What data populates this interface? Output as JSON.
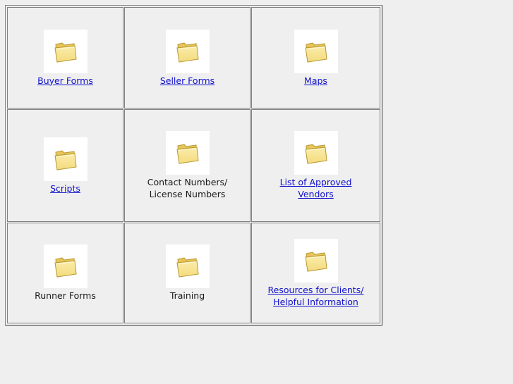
{
  "folders": [
    {
      "label": "Buyer Forms",
      "link": true,
      "icon": "folder-icon"
    },
    {
      "label": "Seller Forms",
      "link": true,
      "icon": "folder-icon"
    },
    {
      "label": "Maps",
      "link": true,
      "icon": "folder-icon"
    },
    {
      "label": "Scripts",
      "link": true,
      "icon": "folder-icon"
    },
    {
      "label": "Contact Numbers/\nLicense Numbers",
      "link": false,
      "icon": "folder-icon"
    },
    {
      "label": "List of Approved \nVendors",
      "link": true,
      "icon": "folder-icon"
    },
    {
      "label": "Runner Forms",
      "link": false,
      "icon": "folder-icon"
    },
    {
      "label": "Training",
      "link": false,
      "icon": "folder-icon"
    },
    {
      "label": "Resources for Clients/\nHelpful Information",
      "link": true,
      "icon": "folder-icon"
    }
  ],
  "colors": {
    "link": "#1111cc",
    "folder_fill": "#f3dc7e",
    "folder_stroke": "#b8962f"
  }
}
